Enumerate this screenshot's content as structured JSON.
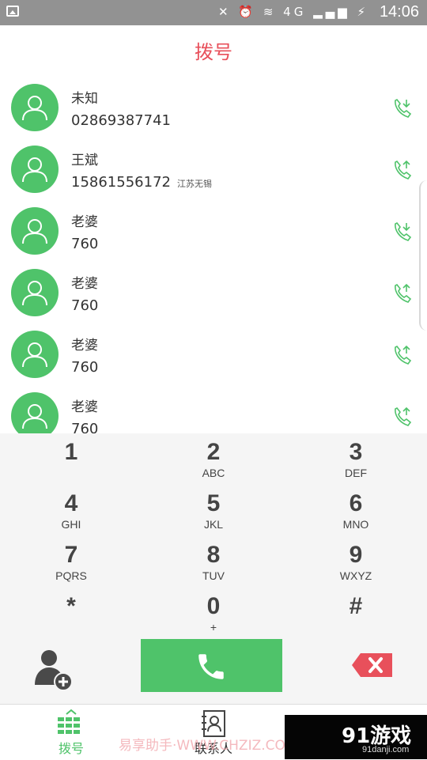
{
  "status_bar": {
    "time": "14:06",
    "indicators": "✕ ⏰ ≋ 4G ▂▄▆ ⚡"
  },
  "header": {
    "title": "拨号"
  },
  "call_log": [
    {
      "name": "未知",
      "number": "02869387741",
      "location": "",
      "direction": "incoming"
    },
    {
      "name": "王斌",
      "number": "15861556172",
      "location": "江苏无锡",
      "direction": "outgoing"
    },
    {
      "name": "老婆",
      "number": "760",
      "location": "",
      "direction": "incoming"
    },
    {
      "name": "老婆",
      "number": "760",
      "location": "",
      "direction": "outgoing"
    },
    {
      "name": "老婆",
      "number": "760",
      "location": "",
      "direction": "outgoing"
    },
    {
      "name": "老婆",
      "number": "760",
      "location": "",
      "direction": "outgoing"
    }
  ],
  "keypad": [
    {
      "digit": "1",
      "letters": ""
    },
    {
      "digit": "2",
      "letters": "ABC"
    },
    {
      "digit": "3",
      "letters": "DEF"
    },
    {
      "digit": "4",
      "letters": "GHI"
    },
    {
      "digit": "5",
      "letters": "JKL"
    },
    {
      "digit": "6",
      "letters": "MNO"
    },
    {
      "digit": "7",
      "letters": "PQRS"
    },
    {
      "digit": "8",
      "letters": "TUV"
    },
    {
      "digit": "9",
      "letters": "WXYZ"
    },
    {
      "digit": "*",
      "letters": ""
    },
    {
      "digit": "0",
      "letters": "+"
    },
    {
      "digit": "#",
      "letters": ""
    }
  ],
  "bottom_nav": {
    "tabs": [
      {
        "label": "拨号",
        "active": true
      },
      {
        "label": "联系人",
        "active": false
      },
      {
        "label": "",
        "active": false
      }
    ]
  },
  "watermark": {
    "text": "易享助手·WWW.CHZIZ.COM"
  },
  "badge": {
    "main": "91游戏",
    "sub": "91danji.com"
  },
  "colors": {
    "accent_green": "#4fc36a",
    "title_red": "#e8505b",
    "status_bar": "#929292",
    "backspace_red": "#e8505b"
  }
}
